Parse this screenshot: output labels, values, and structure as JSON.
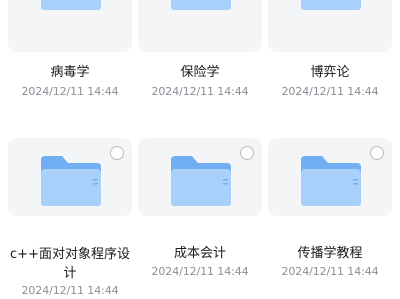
{
  "files": [
    {
      "name": "病毒学",
      "date": "2024/12/11 14:44"
    },
    {
      "name": "保险学",
      "date": "2024/12/11 14:44"
    },
    {
      "name": "博弈论",
      "date": "2024/12/11 14:44"
    },
    {
      "name": "c++面对对象程序设计",
      "date": "2024/12/11 14:44"
    },
    {
      "name": "成本会计",
      "date": "2024/12/11 14:44"
    },
    {
      "name": "传播学教程",
      "date": "2024/12/11 14:44"
    }
  ],
  "colors": {
    "folder_back": "#72aef2",
    "folder_front": "#a9d0fb",
    "thumb_bg": "#f4f5f7",
    "date_text": "#8a8e96"
  }
}
